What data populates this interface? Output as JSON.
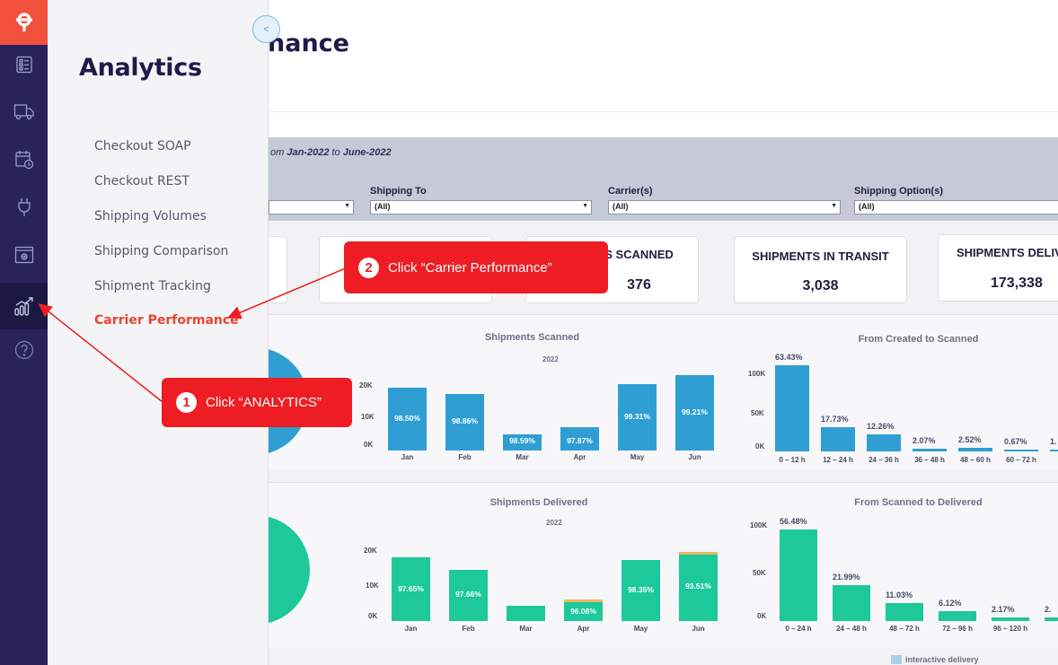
{
  "rail": {
    "icons": [
      "logo-icon",
      "dashboard-icon",
      "truck-icon",
      "calendar-clock-icon",
      "plug-icon",
      "settings-window-icon",
      "analytics-icon",
      "help-icon"
    ]
  },
  "flyout": {
    "title": "Analytics",
    "collapse_label": "<",
    "items": [
      {
        "label": "Checkout SOAP"
      },
      {
        "label": "Checkout REST"
      },
      {
        "label": "Shipping Volumes"
      },
      {
        "label": "Shipping Comparison"
      },
      {
        "label": "Shipment Tracking"
      },
      {
        "label": "Carrier Performance"
      }
    ]
  },
  "page": {
    "title_fragment": "nance"
  },
  "filters": {
    "range_prefix": "om",
    "range_from": "Jan-2022",
    "range_to_word": "to",
    "range_to": "June-2022",
    "fields": [
      {
        "label": "",
        "value": ""
      },
      {
        "label": "Shipping To",
        "value": "(All)"
      },
      {
        "label": "Carrier(s)",
        "value": "(All)"
      },
      {
        "label": "Shipping Option(s)",
        "value": "(All)"
      }
    ]
  },
  "kpis": [
    {
      "label": "",
      "value": ""
    },
    {
      "label": "",
      "value": ""
    },
    {
      "label": "S SCANNED",
      "value": "376"
    },
    {
      "label": "SHIPMENTS IN TRANSIT",
      "value": "3,038"
    },
    {
      "label": "SHIPMENTS DELIVE",
      "value": "173,338"
    }
  ],
  "legend": {
    "interactive_delivery": "interactive delivery"
  },
  "colors": {
    "blue": "#2f9fd3",
    "green": "#1dc89b",
    "accent": "#e8452e",
    "callout": "#ee1d23",
    "rail": "#28245a"
  },
  "annotations": {
    "step1": {
      "number": "1",
      "text": "Click “ANALYTICS”"
    },
    "step2": {
      "number": "2",
      "text": "Click “Carrier Performance”"
    }
  },
  "chart_data": [
    {
      "type": "bar",
      "title": "Shipments Scanned",
      "subtitle": "2022",
      "categories": [
        "Jan",
        "Feb",
        "Mar",
        "Apr",
        "May",
        "Jun"
      ],
      "values": [
        21000,
        19000,
        5500,
        7800,
        22300,
        25300
      ],
      "bar_labels": [
        "98.50%",
        "98.86%",
        "98.59%",
        "97.87%",
        "99.31%",
        "99.21%"
      ],
      "yticks": [
        "20K",
        "10K",
        "0K"
      ],
      "ylim": [
        0,
        30000
      ]
    },
    {
      "type": "bar",
      "title": "From Created to Scanned",
      "categories": [
        "0 – 12 h",
        "12 – 24 h",
        "24 – 36 h",
        "36 – 48 h",
        "48 – 60 h",
        "60 – 72 h",
        ">"
      ],
      "values": [
        63.43,
        17.73,
        12.26,
        2.07,
        2.52,
        0.67,
        1.0
      ],
      "bar_labels": [
        "63.43%",
        "17.73%",
        "12.26%",
        "2.07%",
        "2.52%",
        "0.67%",
        "1."
      ],
      "yticks": [
        "100K",
        "50K",
        "0K"
      ]
    },
    {
      "type": "bar",
      "title": "Shipments Delivered",
      "subtitle": "2022",
      "categories": [
        "Jan",
        "Feb",
        "Mar",
        "Apr",
        "May",
        "Jun"
      ],
      "values": [
        23000,
        18600,
        5500,
        7800,
        22100,
        25100
      ],
      "bar_labels": [
        "97.65%",
        "97.66%",
        "",
        "96.08%",
        "98.35%",
        "93.51%"
      ],
      "yticks": [
        "20K",
        "10K",
        "0K"
      ],
      "ylim": [
        0,
        30000
      ]
    },
    {
      "type": "bar",
      "title": "From Scanned to Delivered",
      "categories": [
        "0 – 24 h",
        "24 – 48 h",
        "48 – 72 h",
        "72 – 96 h",
        "96 – 120 h",
        ">"
      ],
      "values": [
        56.48,
        21.99,
        11.03,
        6.12,
        2.17,
        2.0
      ],
      "bar_labels": [
        "56.48%",
        "21.99%",
        "11.03%",
        "6.12%",
        "2.17%",
        "2."
      ],
      "yticks": [
        "100K",
        "50K",
        "0K"
      ]
    }
  ]
}
